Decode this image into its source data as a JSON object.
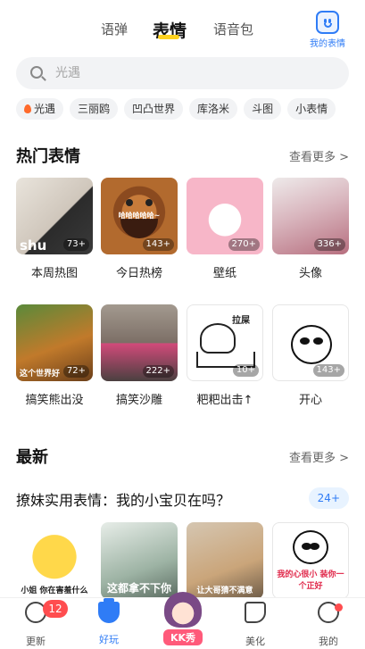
{
  "header": {
    "tabs": [
      {
        "label": "语弹",
        "active": false
      },
      {
        "label": "表情",
        "active": true
      },
      {
        "label": "语音包",
        "active": false
      }
    ],
    "my_emoji_label": "我的表情",
    "accent_color": "#2f7cf6",
    "underline_color": "#ffd21f"
  },
  "search": {
    "placeholder": "光遇",
    "icon": "search-icon"
  },
  "chips": [
    {
      "label": "光遇",
      "icon": "fire-icon"
    },
    {
      "label": "三丽鸥"
    },
    {
      "label": "凹凸世界"
    },
    {
      "label": "库洛米"
    },
    {
      "label": "斗图"
    },
    {
      "label": "小表情"
    }
  ],
  "hot": {
    "title": "热门表情",
    "more_label": "查看更多 >",
    "items": [
      {
        "name": "本周热图",
        "count": "73+",
        "caption": "shu"
      },
      {
        "name": "今日热榜",
        "count": "143+",
        "caption": "哈哈哈哈哈~"
      },
      {
        "name": "壁纸",
        "count": "270+"
      },
      {
        "name": "头像",
        "count": "336+"
      },
      {
        "name": "搞笑熊出没",
        "count": "72+",
        "caption": "这个世界好"
      },
      {
        "name": "搞笑沙雕",
        "count": "222+"
      },
      {
        "name": "粑粑出击↑",
        "count": "10+",
        "caption": "拉屎"
      },
      {
        "name": "开心",
        "count": "143+"
      }
    ]
  },
  "latest": {
    "title": "最新",
    "more_label": "查看更多 >",
    "collection_title": "撩妹实用表情：我的小宝贝在吗？",
    "collection_count": "24+",
    "items": [
      {
        "caption": "小姐 你在害羞什么",
        "caption_color": "#222222"
      },
      {
        "caption": "这都拿不下你",
        "caption_color": "#ffffff"
      },
      {
        "caption": "让大哥猜不满意",
        "caption_color": "#ffffff"
      },
      {
        "caption": "我的心很小 装你一个正好",
        "caption_color": "#e0284a"
      }
    ]
  },
  "bottom_nav": {
    "items": [
      {
        "label": "更新",
        "icon": "update-icon",
        "badge": "12",
        "active": false
      },
      {
        "label": "好玩",
        "icon": "potion-icon",
        "active": true
      },
      {
        "label": "KK秀",
        "icon": "kk-avatar",
        "active": false
      },
      {
        "label": "美化",
        "icon": "brush-icon",
        "active": false
      },
      {
        "label": "我的",
        "icon": "profile-icon",
        "dot": true,
        "active": false
      }
    ]
  }
}
